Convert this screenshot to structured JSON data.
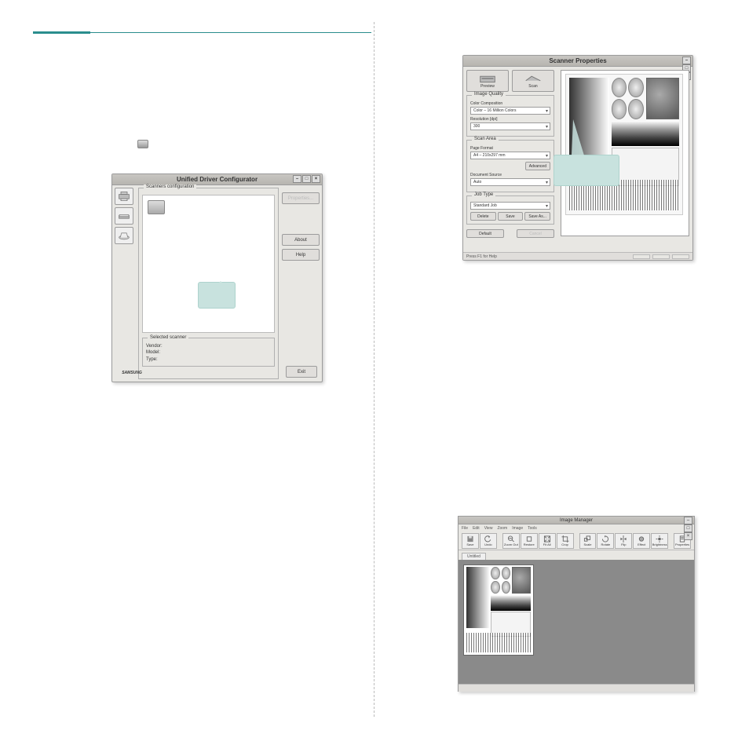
{
  "udc": {
    "title": "Unified Driver Configurator",
    "panel_legend": "Scanners configuration",
    "selected_legend": "Selected scanner",
    "vendor_label": "Vendor:",
    "model_label": "Model:",
    "type_label": "Type:",
    "properties_btn": "Properties...",
    "about_btn": "About",
    "help_btn": "Help",
    "exit_btn": "Exit",
    "samsung": "SAMSUNG"
  },
  "sp": {
    "title": "Scanner Properties",
    "preview_btn": "Preview",
    "scan_btn": "Scan",
    "grp_image_quality": "Image Quality",
    "color_comp_label": "Color Composition",
    "color_comp_value": "Color – 16 Million Colors",
    "resolution_label": "Resolution [dpi]",
    "resolution_value": "300",
    "grp_scan_area": "Scan Area",
    "page_format_label": "Page Format",
    "page_format_value": "A4 – 210x297 mm",
    "advanced_btn": "Advanced",
    "doc_source_label": "Document Source",
    "doc_source_value": "Auto",
    "grp_job_type": "Job Type",
    "job_type_value": "Standard Job",
    "delete_btn": "Delete",
    "save_btn": "Save",
    "saveas_btn": "Save As...",
    "default_btn": "Default",
    "cancel_btn": "Cancel",
    "status": "Press F1 for Help"
  },
  "im": {
    "title": "Image Manager",
    "menu": {
      "file": "File",
      "edit": "Edit",
      "view": "View",
      "zoom": "Zoom",
      "image": "Image",
      "tools": "Tools"
    },
    "tools": {
      "save": "Save",
      "undo": "Undo",
      "zoom_out": "Zoom Out",
      "restore": "Restore",
      "fit_all": "Fit All",
      "crop": "Crop",
      "scale": "Scale",
      "rotate": "Rotate",
      "flip": "Flip",
      "effect": "Effect",
      "brightness": "Brightness",
      "properties": "Properties"
    },
    "tab_untitled": "Untitled",
    "status": ""
  }
}
